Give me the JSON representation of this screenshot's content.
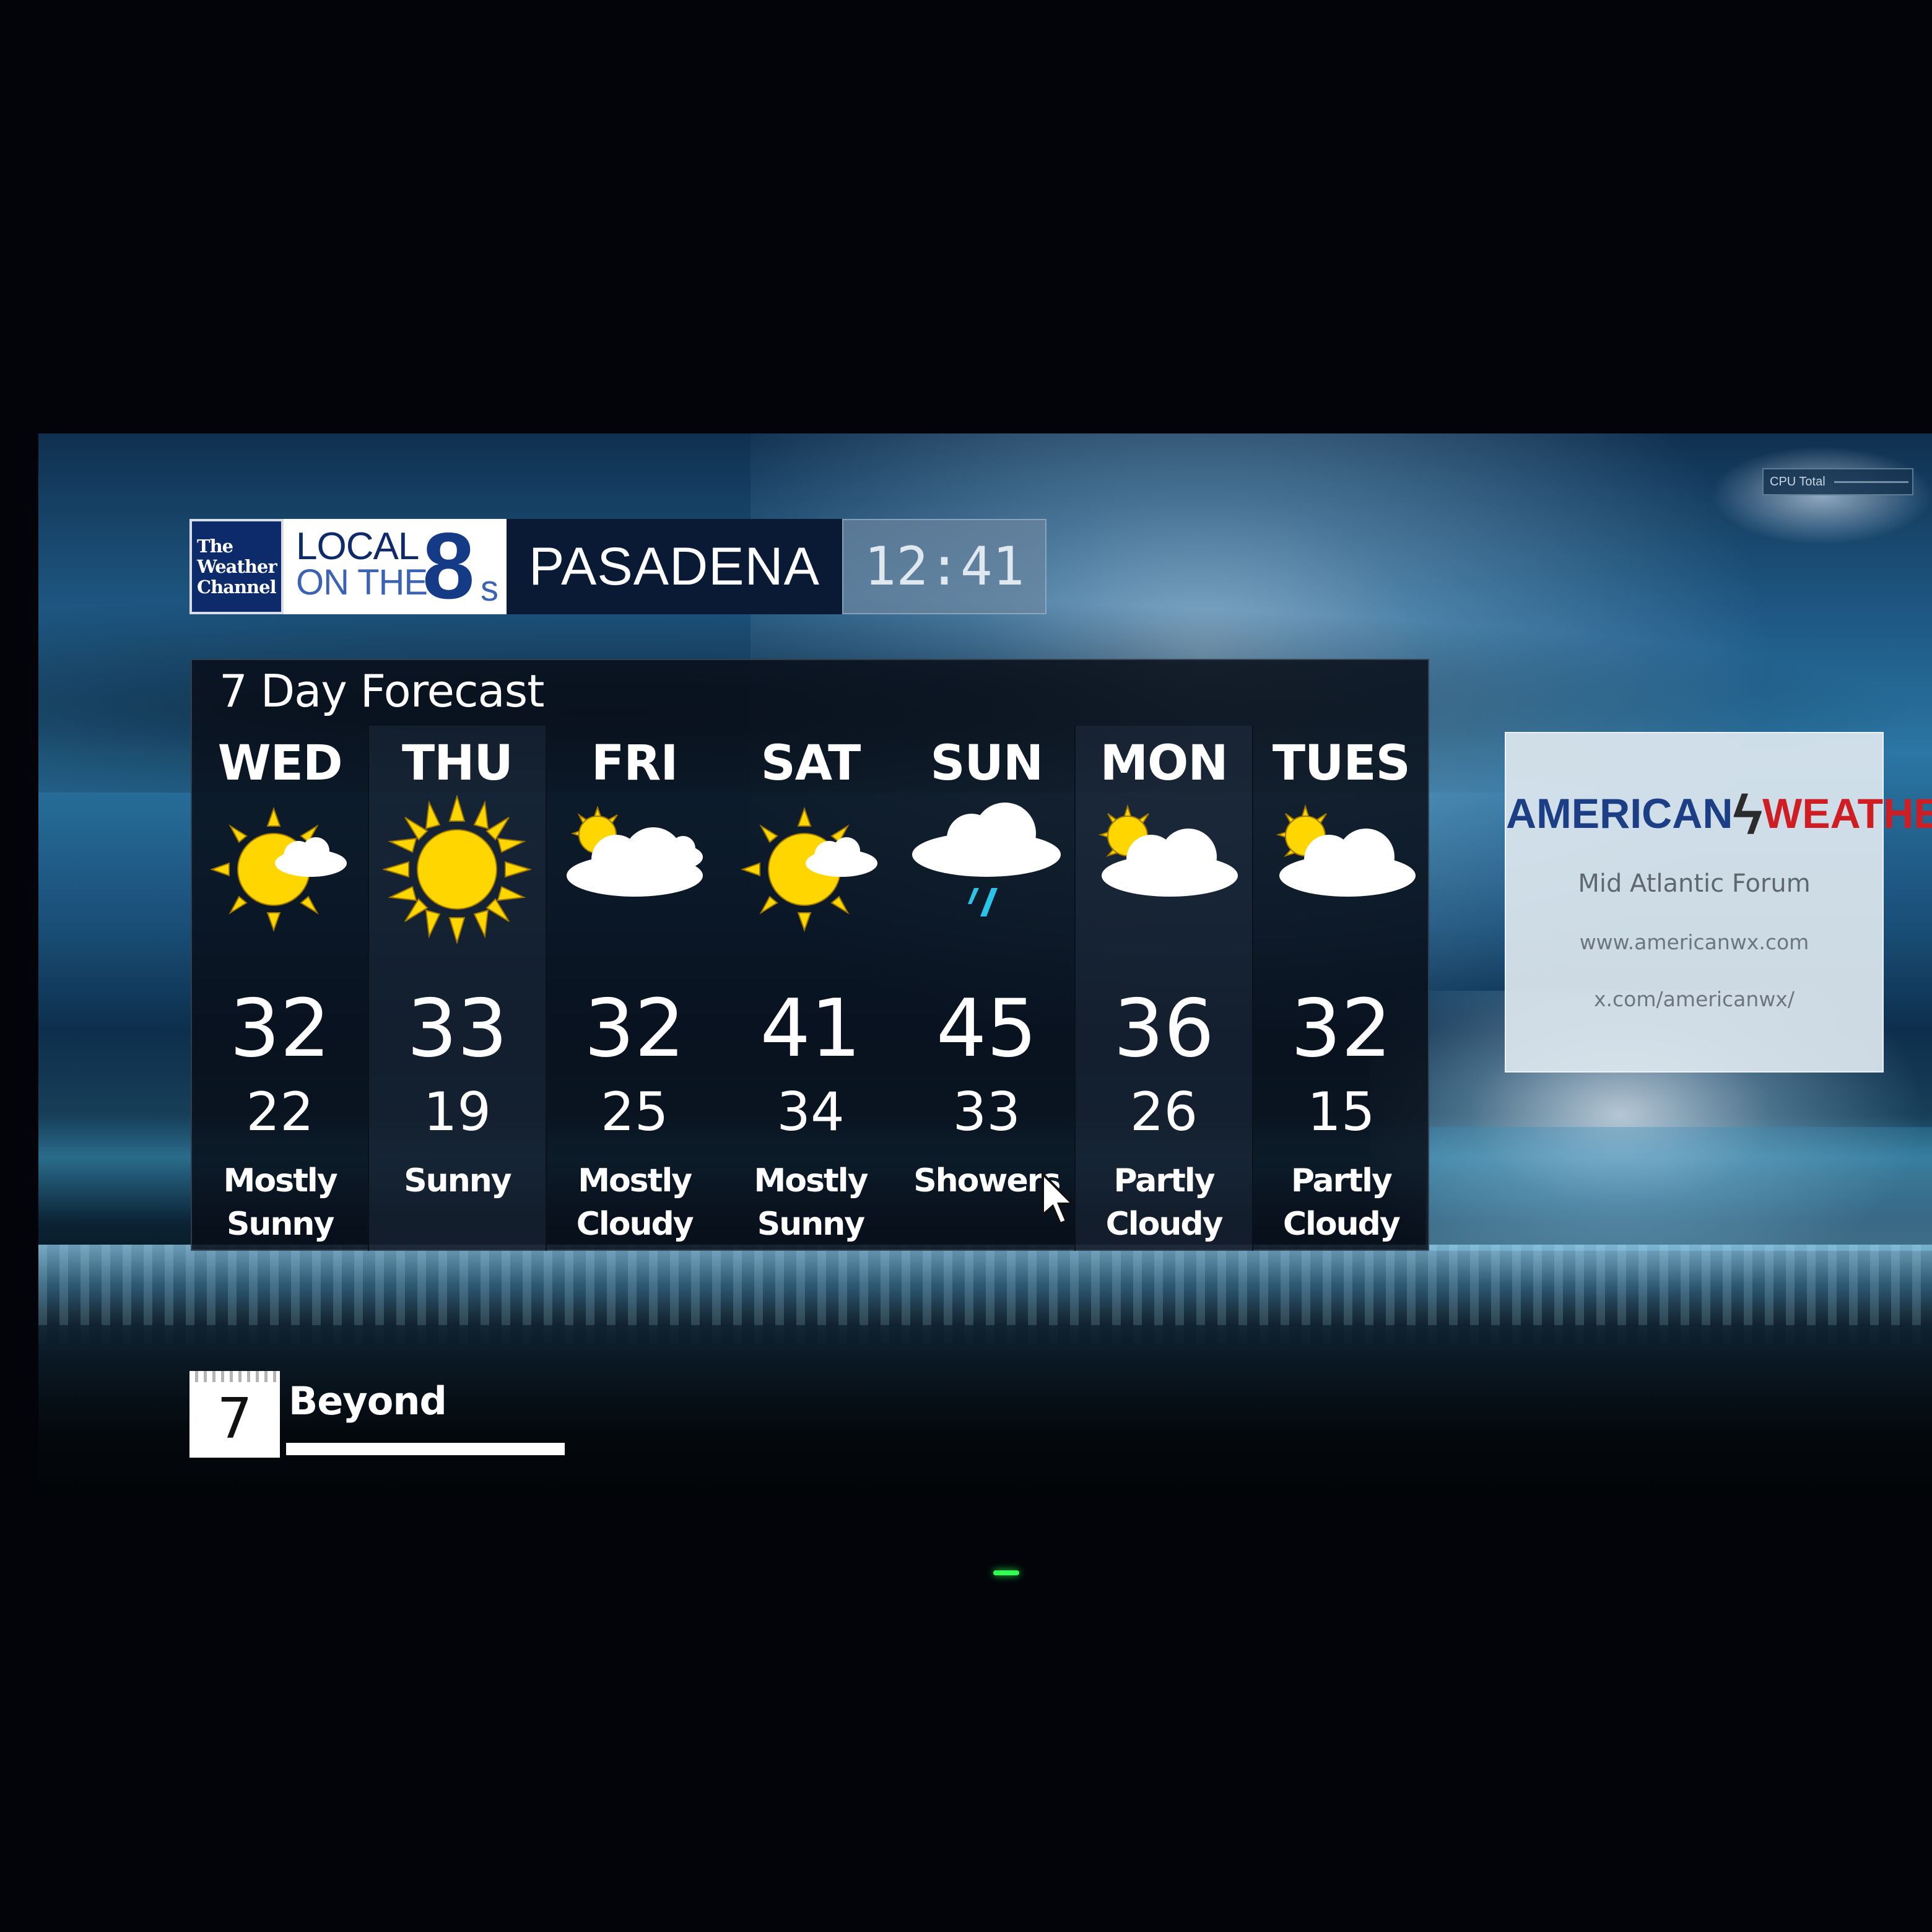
{
  "header": {
    "network_logo": [
      "The",
      "Weather",
      "Channel"
    ],
    "program_line1": "LOCAL",
    "program_line2": "ON THE",
    "program_number": "8",
    "program_suffix": "s",
    "city": "PASADENA",
    "time": "12:41"
  },
  "forecast": {
    "title": "7 Day Forecast",
    "days": [
      {
        "day": "WED",
        "high": "32",
        "low": "22",
        "condition": "Mostly\nSunny",
        "icon": "mostly-sunny-icon"
      },
      {
        "day": "THU",
        "high": "33",
        "low": "19",
        "condition": "Sunny",
        "icon": "sunny-icon"
      },
      {
        "day": "FRI",
        "high": "32",
        "low": "25",
        "condition": "Mostly\nCloudy",
        "icon": "mostly-cloudy-icon"
      },
      {
        "day": "SAT",
        "high": "41",
        "low": "34",
        "condition": "Mostly\nSunny",
        "icon": "mostly-sunny-icon"
      },
      {
        "day": "SUN",
        "high": "45",
        "low": "33",
        "condition": "Showers",
        "icon": "showers-icon"
      },
      {
        "day": "MON",
        "high": "36",
        "low": "26",
        "condition": "Partly\nCloudy",
        "icon": "partly-cloudy-icon"
      },
      {
        "day": "TUES",
        "high": "32",
        "low": "15",
        "condition": "Partly\nCloudy",
        "icon": "partly-cloudy-icon"
      }
    ]
  },
  "sponsor": {
    "brand_left": "AMERICAN",
    "brand_right": "WEATHER",
    "subtitle": "Mid Atlantic Forum",
    "url1": "www.americanwx.com",
    "url2": "x.com/americanwx/"
  },
  "cpu_widget": {
    "label": "CPU Total"
  },
  "footer": {
    "calendar_number": "7",
    "label": "Beyond"
  },
  "colors": {
    "brand_blue": "#1b3e84",
    "brand_red": "#cf1d24",
    "sun_yellow": "#ffd600",
    "rain_cyan": "#29c4e8"
  }
}
